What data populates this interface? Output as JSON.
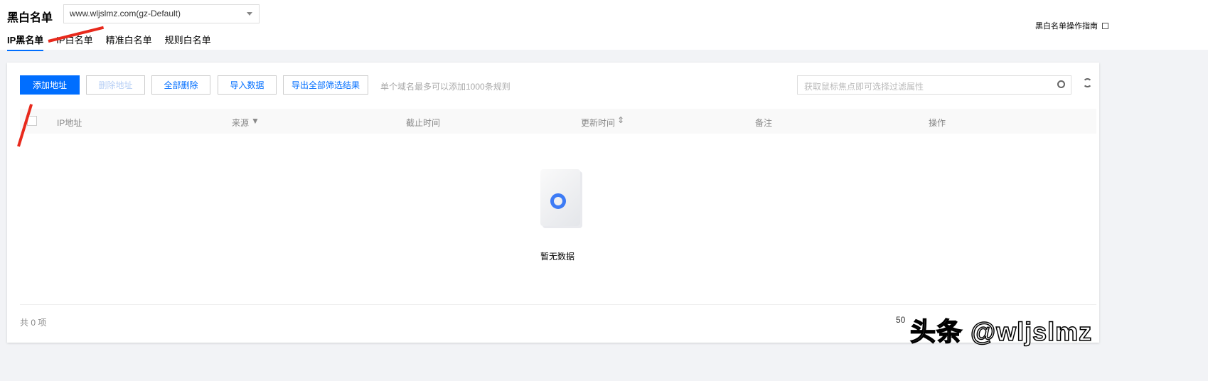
{
  "header": {
    "title": "黑白名单",
    "domain": "www.wljslmz.com(gz-Default)",
    "guide": "黑白名单操作指南"
  },
  "tabs": [
    "IP黑名单",
    "IP白名单",
    "精准白名单",
    "规则白名单"
  ],
  "toolbar": {
    "add": "添加地址",
    "delete": "删除地址",
    "delete_all": "全部删除",
    "import": "导入数据",
    "export": "导出全部筛选结果",
    "hint": "单个域名最多可以添加1000条规则",
    "search_placeholder": "获取鼠标焦点即可选择过滤属性"
  },
  "table": {
    "columns": [
      "IP地址",
      "来源",
      "截止时间",
      "更新时间",
      "备注",
      "操作"
    ],
    "empty": "暂无数据"
  },
  "footer": {
    "total": "共 0 项",
    "page_size": "50"
  },
  "watermark": "头条 @wljslmz",
  "colors": {
    "accent": "#006eff",
    "annotation": "#e8291c"
  }
}
